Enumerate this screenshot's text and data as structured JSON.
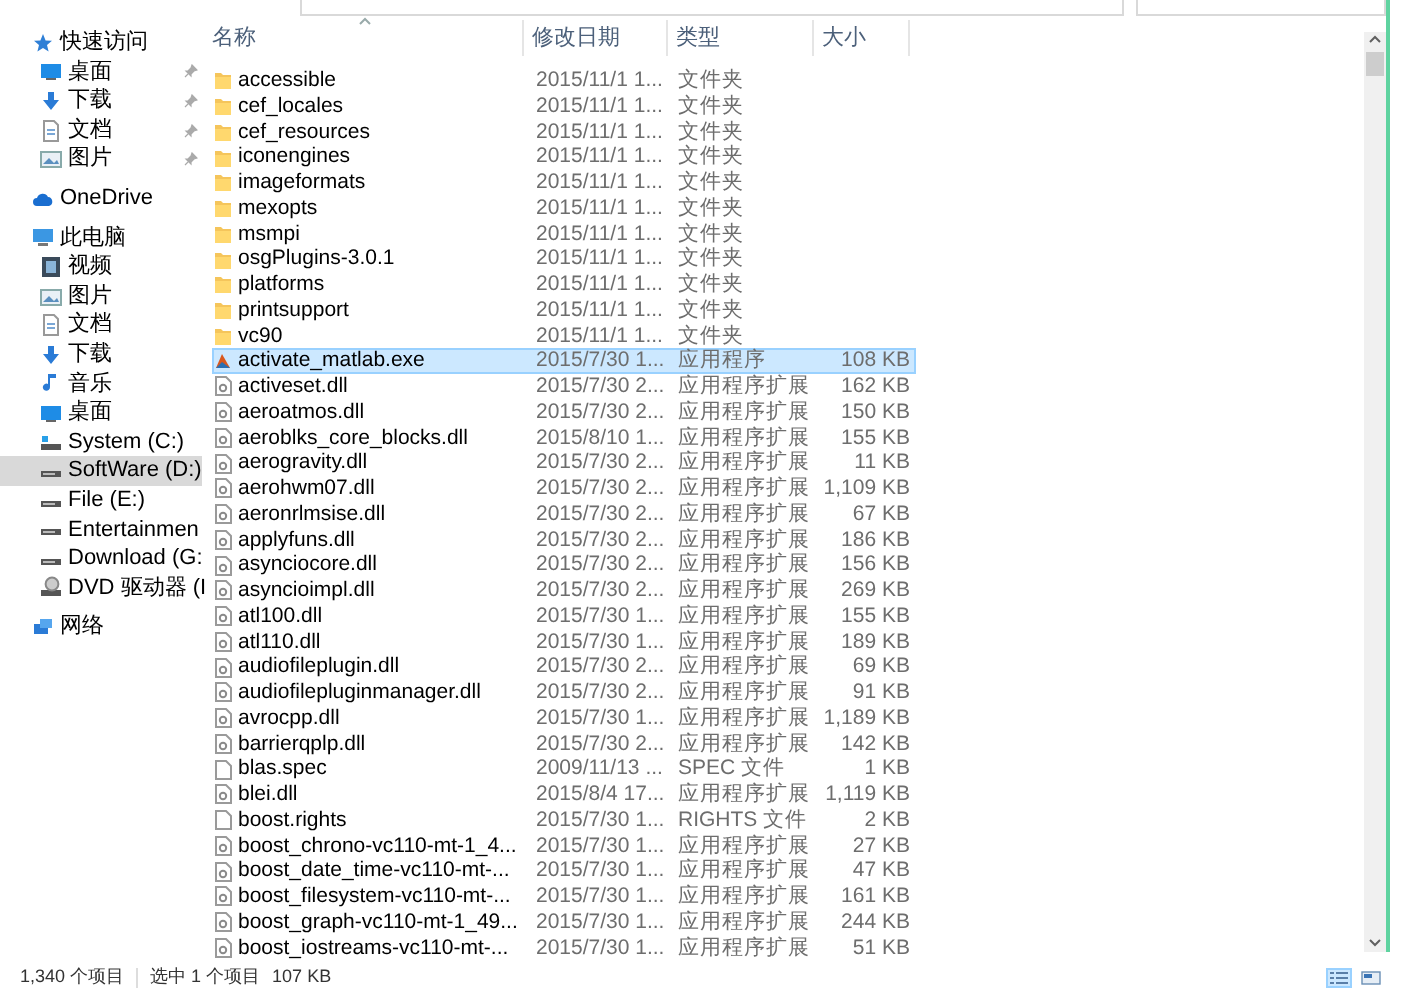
{
  "sidebar": {
    "items": [
      {
        "label": "快速访问",
        "kind": "star",
        "selected": false,
        "children": [
          {
            "label": "桌面",
            "kind": "desktop",
            "pinned": true,
            "selected": false
          },
          {
            "label": "下载",
            "kind": "download",
            "pinned": true,
            "selected": false
          },
          {
            "label": "文档",
            "kind": "document",
            "pinned": true,
            "selected": false
          },
          {
            "label": "图片",
            "kind": "picture",
            "pinned": true,
            "selected": false
          }
        ]
      },
      {
        "label": "OneDrive",
        "kind": "cloud",
        "selected": false
      },
      {
        "label": "此电脑",
        "kind": "pc",
        "selected": false,
        "children": [
          {
            "label": "视频",
            "kind": "video",
            "selected": false
          },
          {
            "label": "图片",
            "kind": "picture",
            "selected": false
          },
          {
            "label": "文档",
            "kind": "document",
            "selected": false
          },
          {
            "label": "下载",
            "kind": "download",
            "selected": false
          },
          {
            "label": "音乐",
            "kind": "music",
            "selected": false
          },
          {
            "label": "桌面",
            "kind": "desktop",
            "selected": false
          },
          {
            "label": "System (C:)",
            "kind": "system-drive",
            "selected": false
          },
          {
            "label": "SoftWare (D:)",
            "kind": "drive",
            "selected": true
          },
          {
            "label": "File (E:)",
            "kind": "drive",
            "selected": false
          },
          {
            "label": "Entertainmen",
            "kind": "drive",
            "selected": false
          },
          {
            "label": "Download (G:",
            "kind": "drive",
            "selected": false
          },
          {
            "label": "DVD 驱动器 (I",
            "kind": "dvd",
            "selected": false
          }
        ]
      },
      {
        "label": "网络",
        "kind": "network",
        "selected": false
      }
    ]
  },
  "file_list": {
    "columns": [
      {
        "label": "名称",
        "sorted": true
      },
      {
        "label": "修改日期",
        "sorted": false
      },
      {
        "label": "类型",
        "sorted": false
      },
      {
        "label": "大小",
        "sorted": false
      }
    ],
    "rows": [
      {
        "kind": "folder",
        "name": "accessible",
        "date": "2015/11/1 1...",
        "type": "文件夹",
        "selected": false
      },
      {
        "kind": "folder",
        "name": "cef_locales",
        "date": "2015/11/1 1...",
        "type": "文件夹",
        "selected": false
      },
      {
        "kind": "folder",
        "name": "cef_resources",
        "date": "2015/11/1 1...",
        "type": "文件夹",
        "selected": false
      },
      {
        "kind": "folder",
        "name": "iconengines",
        "date": "2015/11/1 1...",
        "type": "文件夹",
        "selected": false
      },
      {
        "kind": "folder",
        "name": "imageformats",
        "date": "2015/11/1 1...",
        "type": "文件夹",
        "selected": false
      },
      {
        "kind": "folder",
        "name": "mexopts",
        "date": "2015/11/1 1...",
        "type": "文件夹",
        "selected": false
      },
      {
        "kind": "folder",
        "name": "msmpi",
        "date": "2015/11/1 1...",
        "type": "文件夹",
        "selected": false
      },
      {
        "kind": "folder",
        "name": "osgPlugins-3.0.1",
        "date": "2015/11/1 1...",
        "type": "文件夹",
        "selected": false
      },
      {
        "kind": "folder",
        "name": "platforms",
        "date": "2015/11/1 1...",
        "type": "文件夹",
        "selected": false
      },
      {
        "kind": "folder",
        "name": "printsupport",
        "date": "2015/11/1 1...",
        "type": "文件夹",
        "selected": false
      },
      {
        "kind": "folder",
        "name": "vc90",
        "date": "2015/11/1 1...",
        "type": "文件夹",
        "selected": false
      },
      {
        "kind": "exe",
        "name": "activate_matlab.exe",
        "date": "2015/7/30 1...",
        "type": "应用程序",
        "size": "108 KB",
        "selected": true
      },
      {
        "kind": "dll",
        "name": "activeset.dll",
        "date": "2015/7/30 2...",
        "type": "应用程序扩展",
        "size": "162 KB",
        "selected": false
      },
      {
        "kind": "dll",
        "name": "aeroatmos.dll",
        "date": "2015/7/30 2...",
        "type": "应用程序扩展",
        "size": "150 KB",
        "selected": false
      },
      {
        "kind": "dll",
        "name": "aeroblks_core_blocks.dll",
        "date": "2015/8/10 1...",
        "type": "应用程序扩展",
        "size": "155 KB",
        "selected": false
      },
      {
        "kind": "dll",
        "name": "aerogravity.dll",
        "date": "2015/7/30 2...",
        "type": "应用程序扩展",
        "size": "11 KB",
        "selected": false
      },
      {
        "kind": "dll",
        "name": "aerohwm07.dll",
        "date": "2015/7/30 2...",
        "type": "应用程序扩展",
        "size": "1,109 KB",
        "selected": false
      },
      {
        "kind": "dll",
        "name": "aeronrlmsise.dll",
        "date": "2015/7/30 2...",
        "type": "应用程序扩展",
        "size": "67 KB",
        "selected": false
      },
      {
        "kind": "dll",
        "name": "applyfuns.dll",
        "date": "2015/7/30 2...",
        "type": "应用程序扩展",
        "size": "186 KB",
        "selected": false
      },
      {
        "kind": "dll",
        "name": "asynciocore.dll",
        "date": "2015/7/30 2...",
        "type": "应用程序扩展",
        "size": "156 KB",
        "selected": false
      },
      {
        "kind": "dll",
        "name": "asyncioimpl.dll",
        "date": "2015/7/30 2...",
        "type": "应用程序扩展",
        "size": "269 KB",
        "selected": false
      },
      {
        "kind": "dll",
        "name": "atl100.dll",
        "date": "2015/7/30 1...",
        "type": "应用程序扩展",
        "size": "155 KB",
        "selected": false
      },
      {
        "kind": "dll",
        "name": "atl110.dll",
        "date": "2015/7/30 1...",
        "type": "应用程序扩展",
        "size": "189 KB",
        "selected": false
      },
      {
        "kind": "dll",
        "name": "audiofileplugin.dll",
        "date": "2015/7/30 2...",
        "type": "应用程序扩展",
        "size": "69 KB",
        "selected": false
      },
      {
        "kind": "dll",
        "name": "audiofilepluginmanager.dll",
        "date": "2015/7/30 2...",
        "type": "应用程序扩展",
        "size": "91 KB",
        "selected": false
      },
      {
        "kind": "dll",
        "name": "avrocpp.dll",
        "date": "2015/7/30 1...",
        "type": "应用程序扩展",
        "size": "1,189 KB",
        "selected": false
      },
      {
        "kind": "dll",
        "name": "barrierqplp.dll",
        "date": "2015/7/30 2...",
        "type": "应用程序扩展",
        "size": "142 KB",
        "selected": false
      },
      {
        "kind": "file",
        "name": "blas.spec",
        "date": "2009/11/13 ...",
        "type": "SPEC 文件",
        "size": "1 KB",
        "selected": false
      },
      {
        "kind": "dll",
        "name": "blei.dll",
        "date": "2015/8/4 17...",
        "type": "应用程序扩展",
        "size": "1,119 KB",
        "selected": false
      },
      {
        "kind": "file",
        "name": "boost.rights",
        "date": "2015/7/30 1...",
        "type": "RIGHTS 文件",
        "size": "2 KB",
        "selected": false
      },
      {
        "kind": "dll",
        "name": "boost_chrono-vc110-mt-1_4...",
        "date": "2015/7/30 1...",
        "type": "应用程序扩展",
        "size": "27 KB",
        "selected": false
      },
      {
        "kind": "dll",
        "name": "boost_date_time-vc110-mt-...",
        "date": "2015/7/30 1...",
        "type": "应用程序扩展",
        "size": "47 KB",
        "selected": false
      },
      {
        "kind": "dll",
        "name": "boost_filesystem-vc110-mt-...",
        "date": "2015/7/30 1...",
        "type": "应用程序扩展",
        "size": "161 KB",
        "selected": false
      },
      {
        "kind": "dll",
        "name": "boost_graph-vc110-mt-1_49...",
        "date": "2015/7/30 1...",
        "type": "应用程序扩展",
        "size": "244 KB",
        "selected": false
      },
      {
        "kind": "dll",
        "name": "boost_iostreams-vc110-mt-...",
        "date": "2015/7/30 1...",
        "type": "应用程序扩展",
        "size": "51 KB",
        "selected": false
      }
    ]
  },
  "status_bar": {
    "item_count": "1,340 个项目",
    "selection": "选中 1 个项目",
    "selection_size": "107 KB"
  },
  "view_buttons": [
    {
      "kind": "details",
      "selected": true
    },
    {
      "kind": "tiles",
      "selected": false
    }
  ]
}
